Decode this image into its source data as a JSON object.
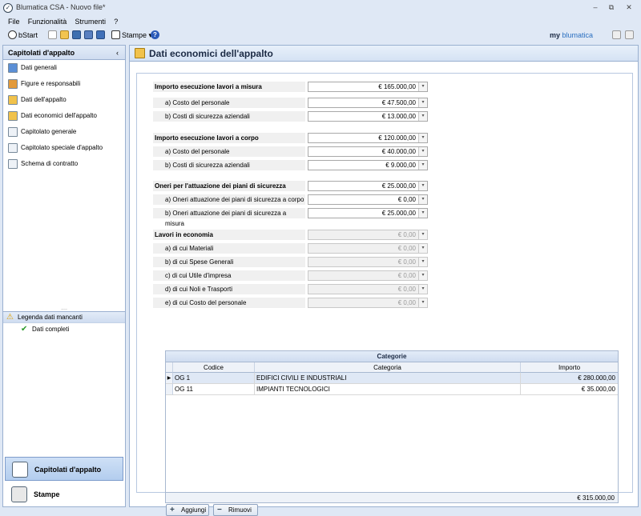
{
  "window": {
    "title": "Blumatica CSA - Nuovo file*"
  },
  "menu": [
    "File",
    "Funzionalità",
    "Strumenti",
    "?"
  ],
  "toolbar": {
    "bstart": "bStart",
    "stampe": "Stampe"
  },
  "brand": {
    "my": "my",
    "name": "blumatica"
  },
  "sidebar": {
    "title": "Capitolati d'appalto",
    "items": [
      "Dati generali",
      "Figure e responsabili",
      "Dati dell'appalto",
      "Dati economici dell'appalto",
      "Capitolato generale",
      "Capitolato speciale d'appalto",
      "Schema di contratto"
    ],
    "legend_title": "Legenda dati mancanti",
    "legend_item": "Dati completi",
    "dots": "....",
    "nav_buttons": [
      "Capitolati d'appalto",
      "Stampe"
    ]
  },
  "main": {
    "title": "Dati economici dell'appalto",
    "rows": [
      {
        "label": "Importo esecuzione lavori a misura",
        "value": "€ 165.000,00",
        "type": "group",
        "disabled": false
      },
      {
        "label": "a) Costo del personale",
        "value": "€ 47.500,00",
        "type": "sub",
        "disabled": false
      },
      {
        "label": "b) Costi di sicurezza aziendali",
        "value": "€ 13.000,00",
        "type": "sub",
        "disabled": false
      },
      {
        "label": "Importo esecuzione lavori a corpo",
        "value": "€ 120.000,00",
        "type": "group",
        "disabled": false
      },
      {
        "label": "a) Costo del personale",
        "value": "€ 40.000,00",
        "type": "sub",
        "disabled": false
      },
      {
        "label": "b) Costi di sicurezza aziendali",
        "value": "€ 9.000,00",
        "type": "sub",
        "disabled": false
      },
      {
        "label": "Oneri per l'attuazione dei piani di sicurezza",
        "value": "€ 25.000,00",
        "type": "group",
        "disabled": false
      },
      {
        "label": "a) Oneri attuazione dei piani di sicurezza a corpo",
        "value": "€ 0,00",
        "type": "sub",
        "disabled": false
      },
      {
        "label": "b) Oneri attuazione dei piani di sicurezza a misura",
        "value": "€ 25.000,00",
        "type": "sub",
        "disabled": false
      },
      {
        "label": "Lavori in economia",
        "value": "€ 0,00",
        "type": "group",
        "disabled": true
      },
      {
        "label": "a) di cui Materiali",
        "value": "€ 0,00",
        "type": "sub",
        "disabled": true
      },
      {
        "label": "b) di cui Spese Generali",
        "value": "€ 0,00",
        "type": "sub",
        "disabled": true
      },
      {
        "label": "c) di cui Utile d'impresa",
        "value": "€ 0,00",
        "type": "sub",
        "disabled": true
      },
      {
        "label": "d) di cui Noli e Trasporti",
        "value": "€ 0,00",
        "type": "sub",
        "disabled": true
      },
      {
        "label": "e) di cui Costo del personale",
        "value": "€ 0,00",
        "type": "sub",
        "disabled": true
      }
    ],
    "grid": {
      "title": "Categorie",
      "headers": [
        "Codice",
        "Categoria",
        "Importo"
      ],
      "rows": [
        {
          "codice": "OG 1",
          "categoria": "EDIFICI CIVILI E INDUSTRIALI",
          "importo": "€ 280.000,00"
        },
        {
          "codice": "OG 11",
          "categoria": "IMPIANTI TECNOLOGICI",
          "importo": "€ 35.000,00"
        }
      ],
      "total": "€ 315.000,00"
    },
    "buttons": {
      "add": "Aggiungi",
      "remove": "Rimuovi"
    }
  }
}
